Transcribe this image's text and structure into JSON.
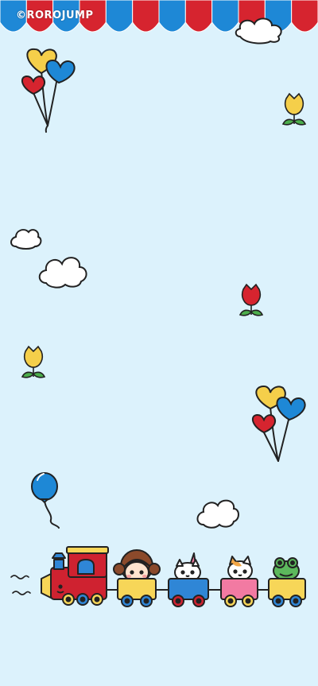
{
  "watermark": {
    "text": "©ROROJUMP"
  },
  "colors": {
    "background": "#dcf2fc",
    "awning_red": "#d6242f",
    "awning_blue": "#1e88d6",
    "balloon_yellow": "#f5cf4a",
    "balloon_blue": "#1e88d6",
    "balloon_red": "#d6242f",
    "train_red": "#cf2230",
    "car_yellow": "#f7d658",
    "car_blue": "#2f86d6",
    "car_pink": "#f27aa2",
    "cloud_white": "#ffffff"
  },
  "scene": {
    "awning_stripes": [
      "blue",
      "red",
      "blue",
      "red",
      "blue",
      "red",
      "blue",
      "red",
      "blue",
      "red",
      "blue",
      "red"
    ],
    "icons": [
      "awning-icon",
      "heart-balloons-icon",
      "tulip-icon",
      "cloud-icon",
      "balloon-icon",
      "train-icon",
      "girl-passenger-icon",
      "unicorn-passenger-icon",
      "cat-passenger-icon",
      "frog-passenger-icon"
    ]
  }
}
